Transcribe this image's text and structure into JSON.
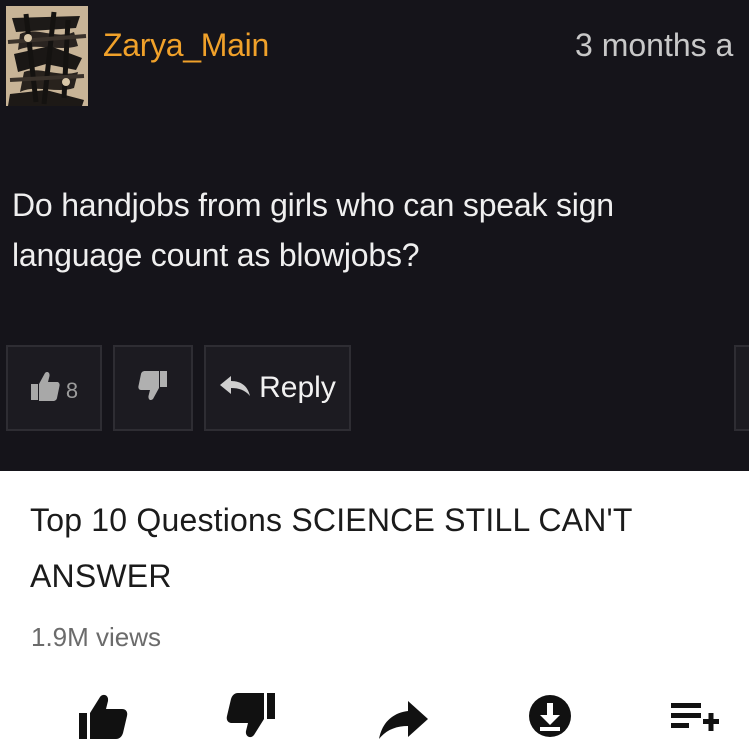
{
  "comment": {
    "username": "Zarya_Main",
    "timestamp": "3 months a",
    "text": "Do handjobs from girls who can speak sign language count as blowjobs?",
    "like_count": "8",
    "reply_label": "Reply",
    "colors": {
      "background": "#15141a",
      "username": "#f0a12a",
      "button_bg": "#1c1b21"
    },
    "icons": {
      "like": "thumbs-up-icon",
      "dislike": "thumbs-down-icon",
      "reply": "reply-arrow-icon",
      "avatar": "scribbled-avatar"
    }
  },
  "video": {
    "title": "Top 10 Questions SCIENCE STILL CAN'T ANSWER",
    "views": "1.9M views",
    "actions": [
      {
        "icon": "thumbs-up-icon"
      },
      {
        "icon": "thumbs-down-icon"
      },
      {
        "icon": "share-icon"
      },
      {
        "icon": "download-icon"
      },
      {
        "icon": "add-to-playlist-icon"
      }
    ]
  }
}
